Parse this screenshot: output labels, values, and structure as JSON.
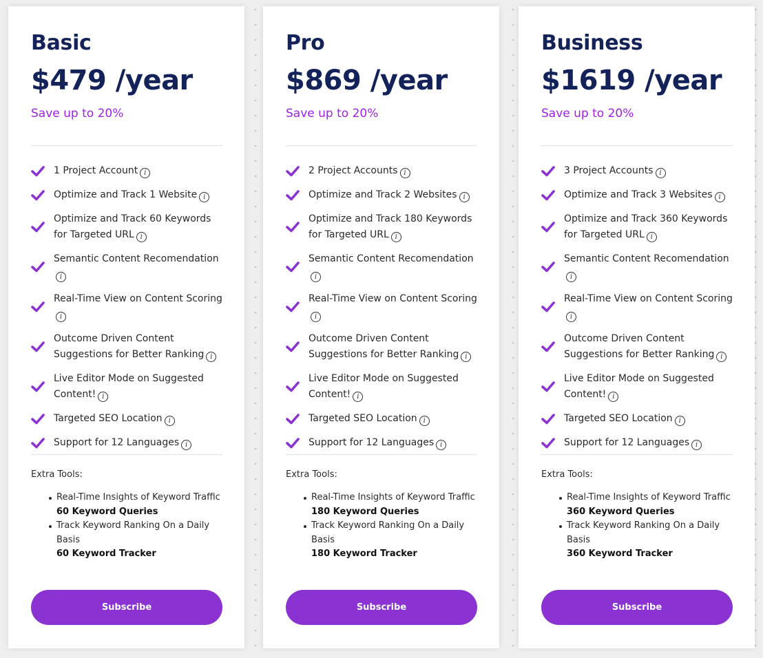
{
  "accent_color": "#8b32d2",
  "save_color": "#a020e8",
  "title_color": "#14225a",
  "plans": [
    {
      "name": "Basic",
      "price": "$479 /year",
      "save": "Save up to 20%",
      "features": [
        "1 Project Account",
        "Optimize and Track 1 Website",
        "Optimize and Track 60 Keywords for Targeted URL",
        "Semantic Content Recomendation",
        "Real-Time View on Content Scoring",
        "Outcome Driven Content Suggestions for Better Ranking",
        "Live Editor Mode on Suggested Content!",
        "Targeted SEO Location",
        "Support for 12 Languages"
      ],
      "extra_label": "Extra Tools:",
      "extras": [
        {
          "text": "Real-Time Insights of Keyword Traffic",
          "bold": "60 Keyword Queries"
        },
        {
          "text": "Track Keyword Ranking On a Daily Basis",
          "bold": "60 Keyword Tracker"
        }
      ],
      "button": "Subscribe"
    },
    {
      "name": "Pro",
      "price": "$869 /year",
      "save": "Save up to 20%",
      "features": [
        "2 Project Accounts",
        "Optimize and Track 2 Websites",
        "Optimize and Track 180 Keywords for Targeted URL",
        "Semantic Content Recomendation",
        "Real-Time View on Content Scoring",
        "Outcome Driven Content Suggestions for Better Ranking",
        "Live Editor Mode on Suggested Content!",
        "Targeted SEO Location",
        "Support for 12 Languages"
      ],
      "extra_label": "Extra Tools:",
      "extras": [
        {
          "text": "Real-Time Insights of Keyword Traffic",
          "bold": "180 Keyword Queries"
        },
        {
          "text": "Track Keyword Ranking On a Daily Basis",
          "bold": "180 Keyword Tracker"
        }
      ],
      "button": "Subscribe"
    },
    {
      "name": "Business",
      "price": "$1619 /year",
      "save": "Save up to 20%",
      "features": [
        "3 Project Accounts",
        "Optimize and Track 3 Websites",
        "Optimize and Track 360 Keywords for Targeted URL",
        "Semantic Content Recomendation",
        "Real-Time View on Content Scoring",
        "Outcome Driven Content Suggestions for Better Ranking",
        "Live Editor Mode on Suggested Content!",
        "Targeted SEO Location",
        "Support for 12 Languages"
      ],
      "extra_label": "Extra Tools:",
      "extras": [
        {
          "text": "Real-Time Insights of Keyword Traffic",
          "bold": "360 Keyword Queries"
        },
        {
          "text": "Track Keyword Ranking On a Daily Basis",
          "bold": "360 Keyword Tracker"
        }
      ],
      "button": "Subscribe"
    }
  ],
  "info_glyph": "i"
}
